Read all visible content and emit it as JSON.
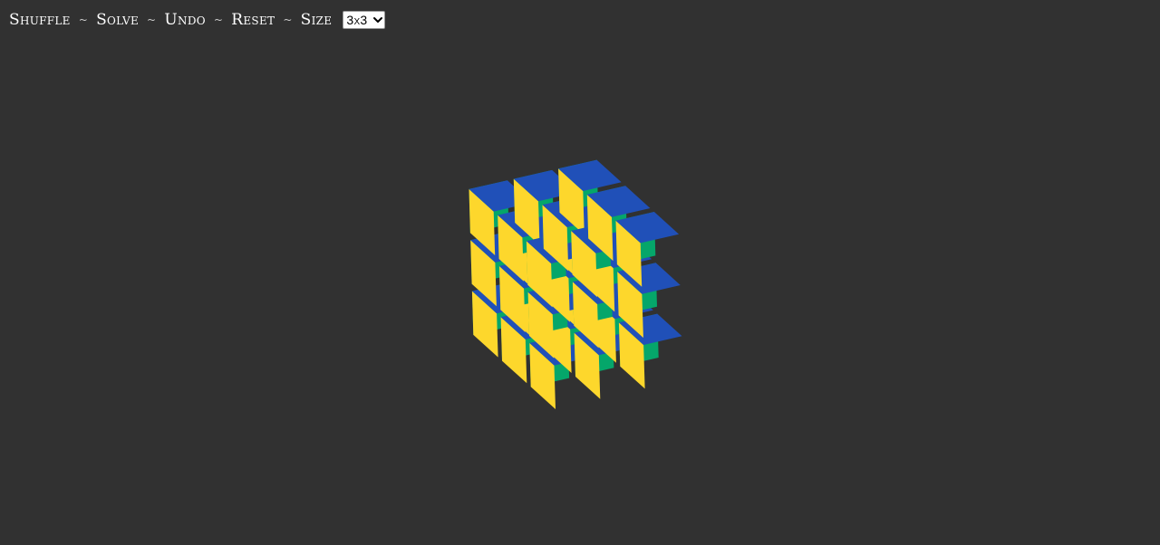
{
  "toolbar": {
    "actions": [
      {
        "label": "Shuffle"
      },
      {
        "label": "Solve"
      },
      {
        "label": "Undo"
      },
      {
        "label": "Reset"
      }
    ],
    "separator": "~",
    "size_label": "Size",
    "size_value": "3x3"
  },
  "cube": {
    "size": 3,
    "colors": {
      "top": "#2050b8",
      "right": "#fdd72c",
      "left": "#05a66a"
    }
  }
}
